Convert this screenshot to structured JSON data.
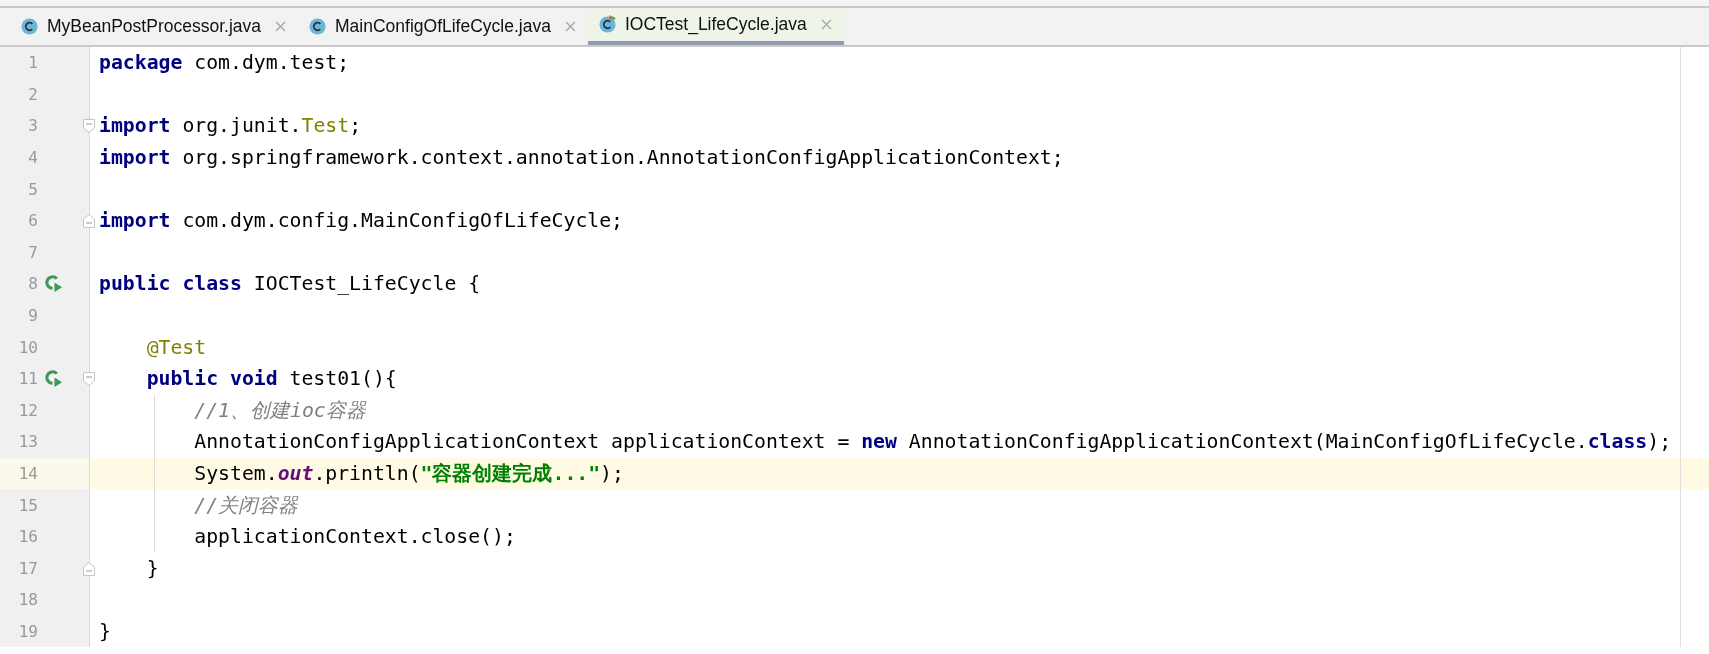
{
  "tabs": [
    {
      "label": "MyBeanPostProcessor.java",
      "selected": false,
      "run_marker": false
    },
    {
      "label": "MainConfigOfLifeCycle.java",
      "selected": false,
      "run_marker": false
    },
    {
      "label": "IOCTest_LifeCycle.java",
      "selected": true,
      "run_marker": true
    }
  ],
  "editor": {
    "lines": [
      {
        "number": "1",
        "runnable": false,
        "fold_start": false,
        "fold_end": false,
        "current": false,
        "tokens": [
          {
            "kind": "keyword",
            "text": "package"
          },
          {
            "kind": "plain",
            "text": " com.dym.test;"
          }
        ]
      },
      {
        "number": "2",
        "runnable": false,
        "fold_start": false,
        "fold_end": false,
        "current": false
      },
      {
        "number": "3",
        "runnable": false,
        "fold_start": true,
        "fold_end": false,
        "current": false,
        "tokens": [
          {
            "kind": "keyword",
            "text": "import"
          },
          {
            "kind": "plain",
            "text": " org.junit."
          },
          {
            "kind": "type",
            "text": "Test"
          },
          {
            "kind": "plain",
            "text": ";"
          }
        ]
      },
      {
        "number": "4",
        "runnable": false,
        "fold_start": false,
        "fold_end": false,
        "current": false,
        "tokens": [
          {
            "kind": "keyword",
            "text": "import"
          },
          {
            "kind": "plain",
            "text": " org.springframework.context.annotation.AnnotationConfigApplicationContext;"
          }
        ]
      },
      {
        "number": "5",
        "runnable": false,
        "fold_start": false,
        "fold_end": false,
        "current": false
      },
      {
        "number": "6",
        "runnable": false,
        "fold_start": false,
        "fold_end": true,
        "current": false,
        "tokens": [
          {
            "kind": "keyword",
            "text": "import"
          },
          {
            "kind": "plain",
            "text": " com.dym.config.MainConfigOfLifeCycle;"
          }
        ]
      },
      {
        "number": "7",
        "runnable": false,
        "fold_start": false,
        "fold_end": false,
        "current": false
      },
      {
        "number": "8",
        "runnable": true,
        "fold_start": false,
        "fold_end": false,
        "current": false,
        "tokens": [
          {
            "kind": "keyword",
            "text": "public"
          },
          {
            "kind": "keyword",
            "text": " class"
          },
          {
            "kind": "plain",
            "text": " IOCTest_LifeCycle {"
          }
        ]
      },
      {
        "number": "9",
        "runnable": false,
        "fold_start": false,
        "fold_end": false,
        "current": false
      },
      {
        "number": "10",
        "runnable": false,
        "fold_start": false,
        "fold_end": false,
        "current": false,
        "tokens": [
          {
            "kind": "annotation",
            "text": "    @Test"
          }
        ]
      },
      {
        "number": "11",
        "runnable": true,
        "fold_start": true,
        "fold_end": false,
        "current": false,
        "tokens": [
          {
            "kind": "keyword",
            "text": "    public"
          },
          {
            "kind": "keyword",
            "text": " void"
          },
          {
            "kind": "plain",
            "text": " test01(){"
          }
        ]
      },
      {
        "number": "12",
        "runnable": false,
        "fold_start": false,
        "fold_end": false,
        "current": false,
        "tokens": [
          {
            "kind": "comment",
            "text": "        //1、创建ioc容器"
          }
        ]
      },
      {
        "number": "13",
        "runnable": false,
        "fold_start": false,
        "fold_end": false,
        "current": false,
        "tokens": [
          {
            "kind": "plain",
            "text": "        AnnotationConfigApplicationContext applicationContext = "
          },
          {
            "kind": "keyword",
            "text": "new"
          },
          {
            "kind": "plain",
            "text": " AnnotationConfigApplicationContext(MainConfigOfLifeCycle."
          },
          {
            "kind": "keyword",
            "text": "class"
          },
          {
            "kind": "plain",
            "text": ");"
          }
        ]
      },
      {
        "number": "14",
        "runnable": false,
        "fold_start": false,
        "fold_end": false,
        "current": true,
        "tokens": [
          {
            "kind": "plain",
            "text": "        System."
          },
          {
            "kind": "static",
            "text": "out"
          },
          {
            "kind": "plain",
            "text": ".println("
          },
          {
            "kind": "string",
            "text": "\"容器创建完成...\""
          },
          {
            "kind": "plain",
            "text": ");"
          }
        ]
      },
      {
        "number": "15",
        "runnable": false,
        "fold_start": false,
        "fold_end": false,
        "current": false,
        "tokens": [
          {
            "kind": "comment",
            "text": "        //关闭容器"
          }
        ]
      },
      {
        "number": "16",
        "runnable": false,
        "fold_start": false,
        "fold_end": false,
        "current": false,
        "tokens": [
          {
            "kind": "plain",
            "text": "        applicationContext.close();"
          }
        ]
      },
      {
        "number": "17",
        "runnable": false,
        "fold_start": false,
        "fold_end": true,
        "current": false,
        "tokens": [
          {
            "kind": "plain",
            "text": "    }"
          }
        ]
      },
      {
        "number": "18",
        "runnable": false,
        "fold_start": false,
        "fold_end": false,
        "current": false
      },
      {
        "number": "19",
        "runnable": false,
        "fold_start": false,
        "fold_end": false,
        "current": false,
        "tokens": [
          {
            "kind": "plain",
            "text": "}"
          }
        ]
      }
    ]
  }
}
